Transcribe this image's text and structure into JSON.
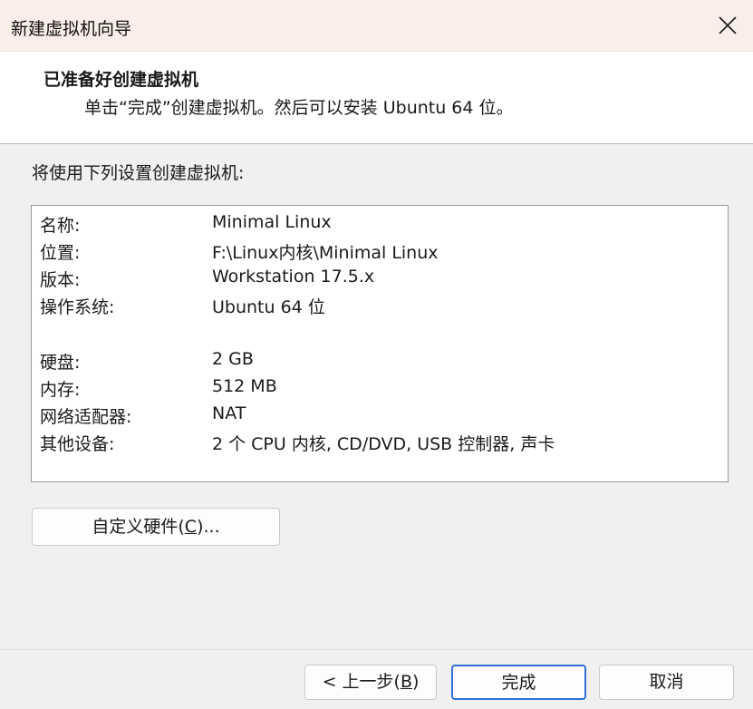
{
  "window": {
    "title": "新建虚拟机向导"
  },
  "header": {
    "title": "已准备好创建虚拟机",
    "subtitle": "单击“完成”创建虚拟机。然后可以安装 Ubuntu 64 位。"
  },
  "body": {
    "label": "将使用下列设置创建虚拟机:"
  },
  "summary": {
    "rows": [
      {
        "key": "名称:",
        "value": "Minimal Linux"
      },
      {
        "key": "位置:",
        "value": "F:\\Linux内核\\Minimal Linux"
      },
      {
        "key": "版本:",
        "value": "Workstation 17.5.x"
      },
      {
        "key": "操作系统:",
        "value": "Ubuntu 64 位"
      },
      {
        "key": "硬盘:",
        "value": "2 GB"
      },
      {
        "key": "内存:",
        "value": "512 MB"
      },
      {
        "key": "网络适配器:",
        "value": "NAT"
      },
      {
        "key": "其他设备:",
        "value": "2 个 CPU 内核, CD/DVD, USB 控制器, 声卡"
      }
    ]
  },
  "buttons": {
    "customize_prefix": "自定义硬件(",
    "customize_accel": "C",
    "customize_suffix": ")...",
    "back_prefix": "< 上一步(",
    "back_accel": "B",
    "back_suffix": ")",
    "finish": "完成",
    "cancel": "取消"
  },
  "icons": {
    "close": "close-icon"
  },
  "colors": {
    "titlebar_bg": "#fbeee9",
    "default_button_border": "#2f6fd6"
  }
}
